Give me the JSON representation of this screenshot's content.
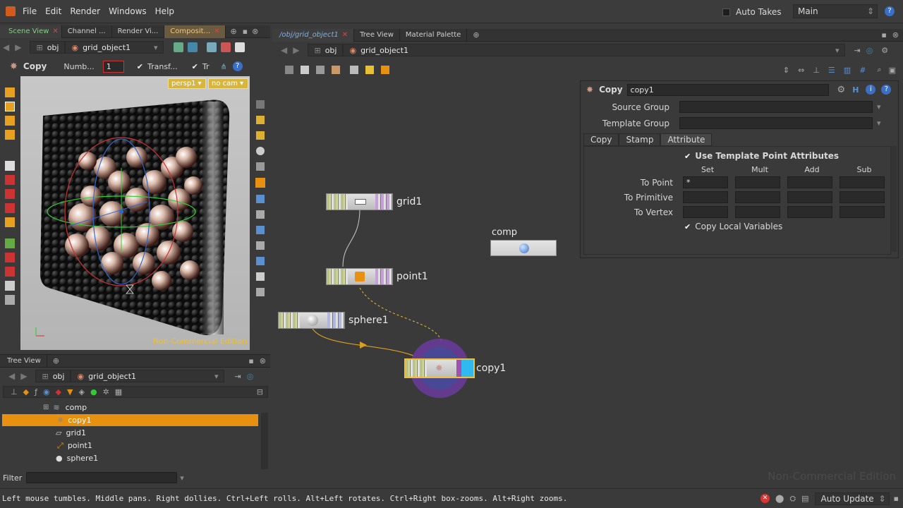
{
  "menu": {
    "items": [
      "File",
      "Edit",
      "Render",
      "Windows",
      "Help"
    ],
    "auto_takes": "Auto Takes",
    "desktop": "Main"
  },
  "left_pane": {
    "tabs": [
      "Scene View",
      "Channel ...",
      "Render Vi...",
      "Composit..."
    ],
    "path": {
      "root": "obj",
      "object": "grid_object1"
    },
    "toolbar": {
      "tool_name": "Copy",
      "number_label": "Numb...",
      "number_value": "1",
      "transform_label": "Transf...",
      "tr_label": "Tr"
    },
    "viewport": {
      "camera": "persp1",
      "cam_menu": "no cam",
      "watermark": "Non-Commercial Edition"
    }
  },
  "network_pane": {
    "tabs": [
      "/obj/grid_object1",
      "Tree View",
      "Material Palette"
    ],
    "path": {
      "root": "obj",
      "object": "grid_object1"
    },
    "nodes": {
      "grid": "grid1",
      "point": "point1",
      "sphere": "sphere1",
      "copy": "copy1",
      "comp": "comp"
    },
    "watermark": "Non-Commercial Edition"
  },
  "params": {
    "node_type": "Copy",
    "node_name": "copy1",
    "source_group_label": "Source Group",
    "template_group_label": "Template Group",
    "tabs": [
      "Copy",
      "Stamp",
      "Attribute"
    ],
    "use_template_point_attributes": "Use Template Point Attributes",
    "columns": [
      "Set",
      "Mult",
      "Add",
      "Sub"
    ],
    "rows": [
      "To Point",
      "To Primitive",
      "To Vertex"
    ],
    "to_point_set": "*",
    "copy_local_variables": "Copy Local Variables"
  },
  "tree_pane": {
    "tab": "Tree View",
    "path": {
      "root": "obj",
      "object": "grid_object1"
    },
    "items": [
      "comp",
      "copy1",
      "grid1",
      "point1",
      "sphere1"
    ],
    "filter_label": "Filter"
  },
  "status": {
    "message": "Left mouse tumbles. Middle pans. Right dollies. Ctrl+Left rolls. Alt+Left rotates. Ctrl+Right box-zooms. Alt+Right zooms.",
    "update_mode": "Auto Update"
  },
  "colors": {
    "selection": "#e8900f",
    "active_tab_text": "#7fd27f",
    "accent_node": "#f0c030"
  }
}
